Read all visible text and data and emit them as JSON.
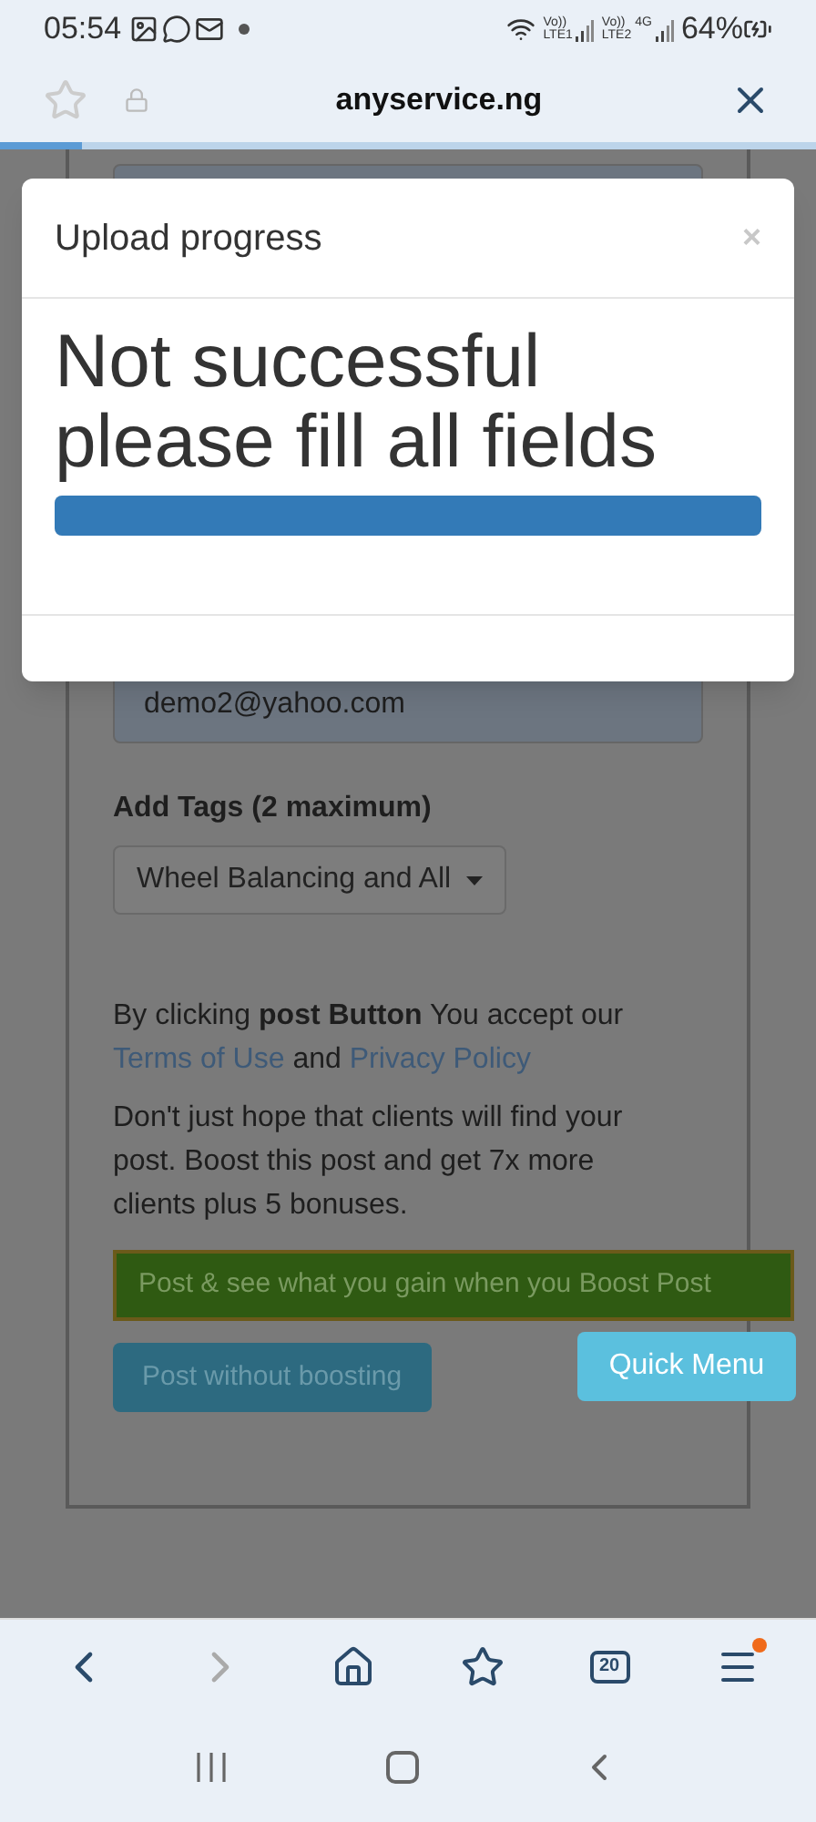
{
  "status_bar": {
    "time": "05:54",
    "signal_labels": [
      {
        "top": "Vo))",
        "bottom": "LTE1"
      },
      {
        "top": "Vo))",
        "bottom": "LTE2"
      }
    ],
    "network": "4G",
    "battery": "64%"
  },
  "browser": {
    "url": "anyservice.ng",
    "load": {
      "level": 0.1
    }
  },
  "form": {
    "email": {
      "value": "demo2@yahoo.com"
    },
    "tags_label": "Add Tags (2 maximum)",
    "tags_dropdown": "Wheel Balancing and All",
    "consent": "By clicking **post Button** You accept our",
    "links": [
      {
        "label": "Terms of Use"
      },
      {
        "label": "Privacy Policy"
      }
    ],
    "and": "and",
    "boost_text": "Don't just hope that clients will find your post. Boost this post and get 7x more clients plus 5 bonuses.",
    "buttons": [
      {
        "label": "Post & see what you gain when you Boost Post",
        "kind": "boost"
      },
      {
        "label": "Post without boosting",
        "kind": "plain"
      }
    ]
  },
  "quick_menu": "Quick Menu",
  "modal": {
    "title": "Upload progress",
    "close": "×",
    "message": "Not successful please fill all fields",
    "progress": {
      "level": 1
    }
  },
  "toolbar": {
    "tab_count": "20",
    "menu_badge": true
  }
}
